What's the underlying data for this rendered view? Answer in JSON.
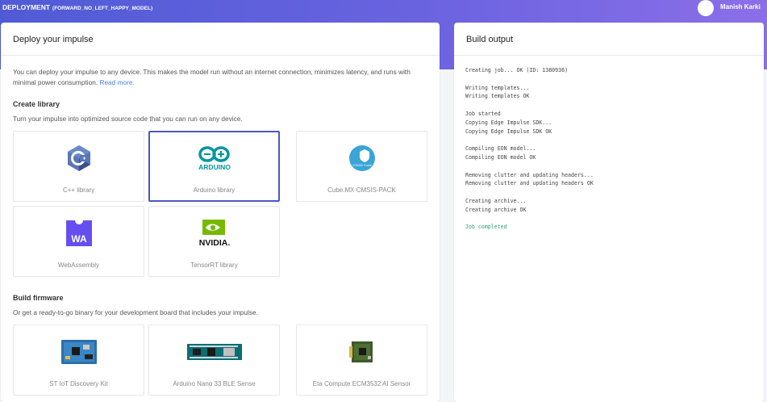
{
  "header": {
    "title": "DEPLOYMENT",
    "subtitle": "(FORWARD_NO_LEFT_HAPPY_MODEL)",
    "user_name": "Manish Karki"
  },
  "deploy": {
    "title": "Deploy your impulse",
    "intro": "You can deploy your impulse to any device. This makes the model run without an internet connection, minimizes latency, and runs with minimal power consumption.",
    "read_more": "Read more.",
    "library_title": "Create library",
    "library_sub": "Turn your impulse into optimized source code that you can run on any device.",
    "libraries": [
      {
        "label": "C++ library",
        "icon": "cpp-logo-icon",
        "selected": false
      },
      {
        "label": "Arduino library",
        "icon": "arduino-logo-icon",
        "logo_text": "ARDUINO",
        "selected": true
      },
      {
        "label": "Cube.MX CMSIS-PACK",
        "icon": "stm32-cube-logo-icon",
        "logo_text": "STM32 Cube",
        "selected": false
      },
      {
        "label": "WebAssembly",
        "icon": "webassembly-logo-icon",
        "logo_text": "WA",
        "selected": false
      },
      {
        "label": "TensorRT library",
        "icon": "nvidia-logo-icon",
        "logo_text": "NVIDIA.",
        "selected": false
      }
    ],
    "firmware_title": "Build firmware",
    "firmware_sub": "Or get a ready-to-go binary for your development board that includes your impulse.",
    "firmwares": [
      {
        "label": "ST IoT Discovery Kit",
        "icon": "board-image-icon"
      },
      {
        "label": "Arduino Nano 33 BLE Sense",
        "icon": "board-image-icon"
      },
      {
        "label": "Eta Compute ECM3532 AI Sensor",
        "icon": "board-image-icon"
      }
    ]
  },
  "build": {
    "title": "Build output",
    "lines": [
      "Creating job... OK (ID: 1380936)",
      "",
      "Writing templates...",
      "Writing templates OK",
      "",
      "Job started",
      "Copying Edge Impulse SDK...",
      "Copying Edge Impulse SDK OK",
      "",
      "Compiling EON model...",
      "Compiling EON model OK",
      "",
      "Removing clutter and updating headers...",
      "Removing clutter and updating headers OK",
      "",
      "Creating archive...",
      "Creating archive OK"
    ],
    "completed": "Job completed"
  },
  "colors": {
    "banner_start": "#4f5bd5",
    "banner_end": "#8b6fe8",
    "selected_border": "#4c57c2",
    "success": "#2ea36b",
    "link": "#4a7ee0"
  }
}
